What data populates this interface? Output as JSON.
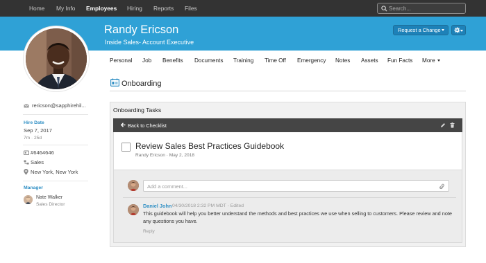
{
  "nav": {
    "items": [
      {
        "label": "Home",
        "active": false
      },
      {
        "label": "My Info",
        "active": false
      },
      {
        "label": "Employees",
        "active": true
      },
      {
        "label": "Hiring",
        "active": false
      },
      {
        "label": "Reports",
        "active": false
      },
      {
        "label": "Files",
        "active": false
      }
    ],
    "search_placeholder": "Search..."
  },
  "profile": {
    "name": "Randy Ericson",
    "job_title": "Inside Sales- Account Executive",
    "request_change_label": "Request a Change",
    "settings_icon": "gear-icon"
  },
  "tabs": [
    "Personal",
    "Job",
    "Benefits",
    "Documents",
    "Training",
    "Time Off",
    "Emergency",
    "Notes",
    "Assets",
    "Fun Facts",
    "More"
  ],
  "sidebar": {
    "email": "rericson@sapphirehil...",
    "hire_date_label": "Hire Date",
    "hire_date": "Sep 7, 2017",
    "tenure": "7m · 25d",
    "employee_id": "#6464646",
    "department": "Sales",
    "location": "New York, New York",
    "manager_label": "Manager",
    "manager_name": "Nate Walker",
    "manager_title": "Sales Director"
  },
  "section": {
    "title": "Onboarding",
    "panel_title": "Onboarding Tasks",
    "back_label": "Back to Checklist"
  },
  "task": {
    "title": "Review Sales Best Practices Guidebook",
    "meta": "Randy Ericson · May 2, 2018",
    "completed": false
  },
  "comments": {
    "placeholder": "Add a comment...",
    "items": [
      {
        "author": "Daniel John",
        "date": "04/30/2018 2:32 PM MDT - Edited",
        "body": "This guidebook will help you better understand the methods and best practices we use when selling to customers. Please review and note any questions you have.",
        "reply_label": "Reply"
      }
    ]
  },
  "colors": {
    "header_blue": "#2fa1d6",
    "nav_dark": "#333333",
    "link_blue": "#2f8fc4",
    "card_bar": "#454545"
  }
}
